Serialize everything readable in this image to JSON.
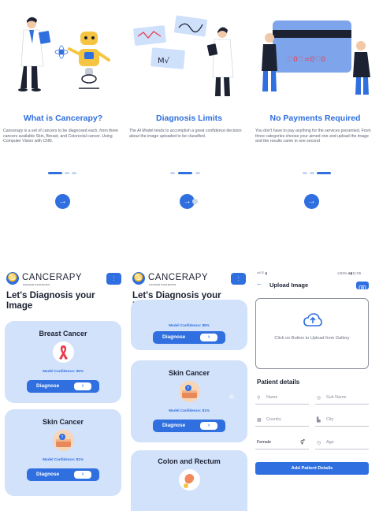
{
  "onboarding": [
    {
      "title": "What is Cancerapy?",
      "description": "Cancerapy is a set of cancers to be diagnosed each, from three cancers available Skin, Breast, and Colorectal cancer. Using Computer Vision with CNN."
    },
    {
      "title": "Diagnosis Limits",
      "description": "The AI Model tends to accomplish a great confidence decision about the image uploaded to be classified."
    },
    {
      "title": "No Payments Required",
      "description": "You don't have to pay anything for the services presented, From three categories choose your aimed one and upload the image and the results came in one second"
    }
  ],
  "illustration": {
    "card_text": "♡0♡=0♡0"
  },
  "app": {
    "brand": "CANCERAPY",
    "tagline": "CANCER DIAGNOSIS",
    "heading_line1": "Let's Diagnosis your",
    "heading_line2": "Image",
    "diagnose_label": "Diagnose",
    "cards": {
      "breast": {
        "title": "Breast Cancer",
        "confidence": "Model Confidence: 99%"
      },
      "skin": {
        "title": "Skin Cancer",
        "confidence": "Model Confidence: 81%"
      },
      "colon": {
        "title": "Colon and Rectum",
        "confidence": "Model Confidence: 88%"
      }
    }
  },
  "upload": {
    "status_left": "ᵛᵒˡᴸᵀᴱ ▮",
    "status_right": "⊙63% ■▮11:56",
    "title": "Upload Image",
    "drop_text": "Click on Button to Upload from Gallery",
    "details_title": "Patient details",
    "fields": {
      "name": "Name",
      "sub_name": "Sub Name",
      "country": "Country",
      "city": "City",
      "gender": "Female",
      "age": "Age"
    },
    "submit_label": "Add Patient Details"
  },
  "colors": {
    "primary": "#2f6fe0",
    "card_bg": "#d2e2fb",
    "ribbon": "#e83c4d"
  }
}
